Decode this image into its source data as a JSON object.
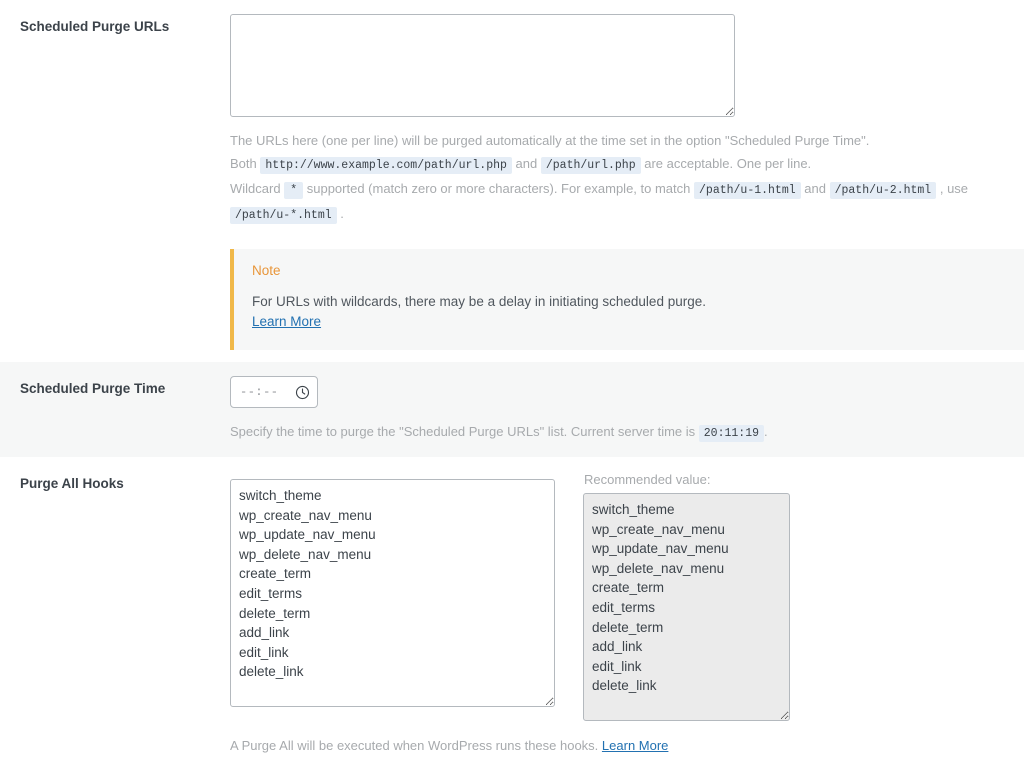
{
  "rows": {
    "scheduled_purge_urls": {
      "label": "Scheduled Purge URLs",
      "textarea_value": "",
      "textarea_placeholder": "",
      "desc_line1_a": "The URLs here (one per line) will be purged automatically at the time set in the option \"Scheduled Purge Time\".",
      "desc_line2_a": "Both",
      "desc_line2_code1": "http://www.example.com/path/url.php",
      "desc_line2_b": "and",
      "desc_line2_code2": "/path/url.php",
      "desc_line2_c": "are acceptable. One per line.",
      "desc_line3_a": "Wildcard",
      "desc_line3_code1": "*",
      "desc_line3_b": "supported (match zero or more characters). For example, to match",
      "desc_line3_code2": "/path/u-1.html",
      "desc_line3_c": "and",
      "desc_line3_code3": "/path/u-2.html",
      "desc_line3_d": ", use",
      "desc_line3_code4": "/path/u-*.html",
      "desc_line3_e": ".",
      "note": {
        "title": "Note",
        "body": "For URLs with wildcards, there may be a delay in initiating scheduled purge.",
        "link": "Learn More"
      }
    },
    "scheduled_purge_time": {
      "label": "Scheduled Purge Time",
      "input_value": "--:--",
      "icon": "clock-icon",
      "desc_a": "Specify the time to purge the \"Scheduled Purge URLs\" list. Current server time is",
      "desc_code": "20:11:19",
      "desc_b": "."
    },
    "purge_all_hooks": {
      "label": "Purge All Hooks",
      "textarea_value": "switch_theme\nwp_create_nav_menu\nwp_update_nav_menu\nwp_delete_nav_menu\ncreate_term\nedit_terms\ndelete_term\nadd_link\nedit_link\ndelete_link",
      "recommended_label": "Recommended value:",
      "recommended_value": "switch_theme\nwp_create_nav_menu\nwp_update_nav_menu\nwp_delete_nav_menu\ncreate_term\nedit_terms\ndelete_term\nadd_link\nedit_link\ndelete_link",
      "hooks_list": [
        "switch_theme",
        "wp_create_nav_menu",
        "wp_update_nav_menu",
        "wp_delete_nav_menu",
        "create_term",
        "edit_terms",
        "delete_term",
        "add_link",
        "edit_link",
        "delete_link"
      ],
      "desc_a": "A Purge All will be executed when WordPress runs these hooks.",
      "desc_link": "Learn More"
    }
  },
  "colors": {
    "accent_link": "#2271b1",
    "note_border": "#f0b849",
    "note_title": "#e8963a",
    "row_stripe": "#f6f7f7",
    "code_chip_bg": "#e5edf6",
    "muted_text": "#a7aaad"
  }
}
